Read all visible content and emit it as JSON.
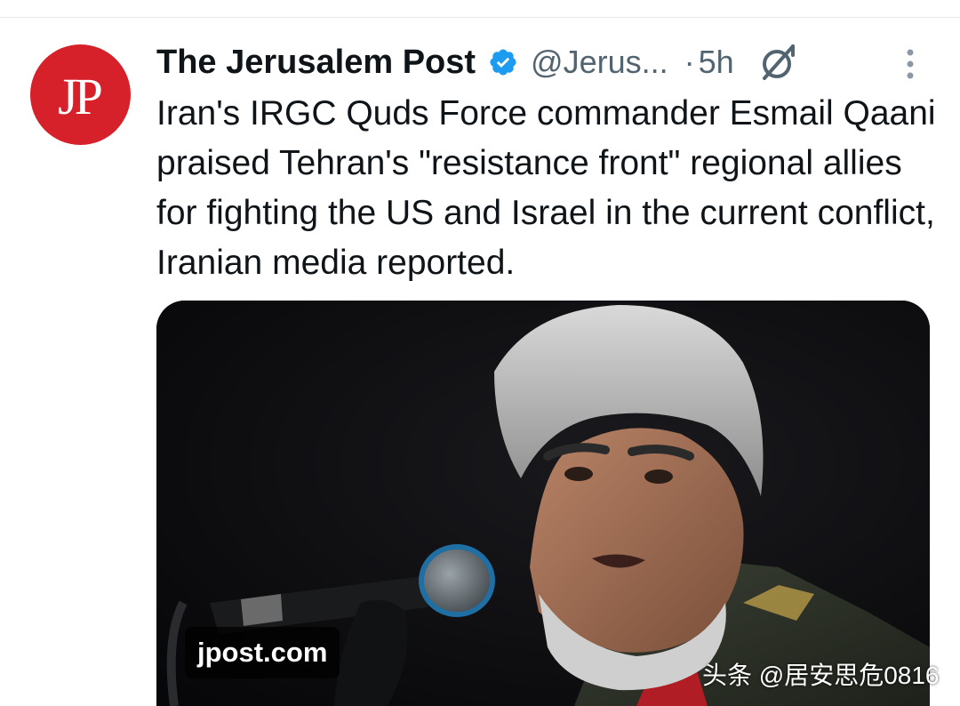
{
  "tweet": {
    "author": {
      "avatar_text": "JP",
      "display_name": "The Jerusalem Post",
      "handle": "@Jerus...",
      "verified": true
    },
    "separator": "·",
    "time": "5h",
    "text": "Iran's IRGC Quds Force commander Esmail Qaani praised Tehran's \"resistance front\" regional allies for fighting the US and Israel in the current conflict, Iranian media reported.",
    "media": {
      "source_domain": "jpost.com"
    },
    "icons": {
      "verified": "verified-badge-icon",
      "grok": "grok-icon",
      "more": "more-vertical-icon"
    }
  },
  "watermark": "头条 @居安思危0816",
  "colors": {
    "avatar_bg": "#d6202a",
    "verified_blue": "#1d9bf0",
    "secondary_text": "#536471",
    "primary_text": "#0f1419"
  }
}
